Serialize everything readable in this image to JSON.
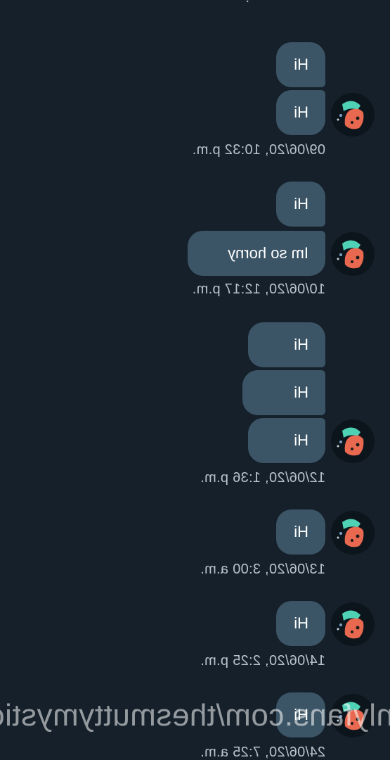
{
  "top_fragment": ". ·",
  "groups": [
    {
      "messages": [
        "Hi",
        "Hi"
      ],
      "timestamp": "09/06/20, 10:32 p.m."
    },
    {
      "messages": [
        "Hi",
        "Im so horny"
      ],
      "timestamp": "10/06/20, 12:17 p.m."
    },
    {
      "messages": [
        "Hi",
        "Hi",
        "Hi"
      ],
      "timestamp": "12/06/20, 1:36 p.m."
    },
    {
      "messages": [
        "Hi"
      ],
      "timestamp": "13/06/20, 3:00 a.m."
    },
    {
      "messages": [
        "Hi"
      ],
      "timestamp": "14/06/20, 2:25 p.m."
    },
    {
      "messages": [
        "Hi"
      ],
      "timestamp": "24/06/20, 7:25 a.m."
    }
  ],
  "watermark": "onlyfans.com/thesmuttymysticc",
  "colors": {
    "background": "#15202b",
    "bubble": "#3c5566",
    "timestamp": "#b8c3cc"
  },
  "avatar_icon": "cartoon-face-avatar-icon"
}
